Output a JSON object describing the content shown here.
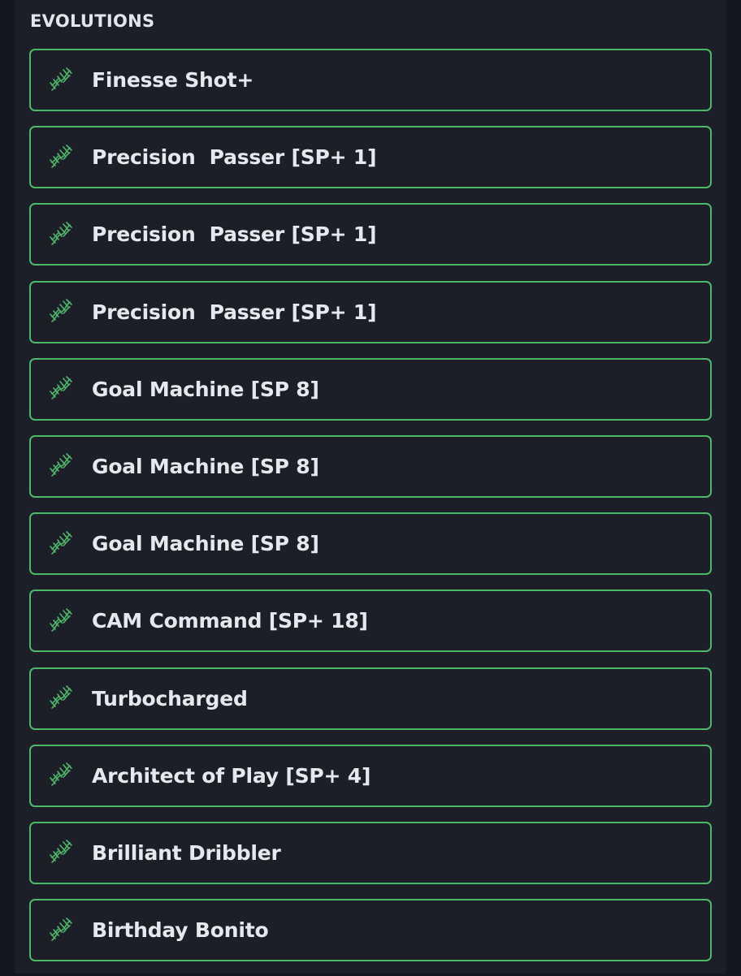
{
  "section": {
    "title": "EVOLUTIONS"
  },
  "colors": {
    "page_background": "#14171d",
    "panel_background": "#1c1f28",
    "item_border": "#4cb86a",
    "icon": "#4cb86a",
    "text": "#e6e8ef"
  },
  "evolutions": [
    {
      "label": "Finesse Shot+",
      "icon": "dna-icon"
    },
    {
      "label": "Precision  Passer [SP+ 1]",
      "icon": "dna-icon"
    },
    {
      "label": "Precision  Passer [SP+ 1]",
      "icon": "dna-icon"
    },
    {
      "label": "Precision  Passer [SP+ 1]",
      "icon": "dna-icon"
    },
    {
      "label": "Goal Machine [SP 8]",
      "icon": "dna-icon"
    },
    {
      "label": "Goal Machine [SP 8]",
      "icon": "dna-icon"
    },
    {
      "label": "Goal Machine [SP 8]",
      "icon": "dna-icon"
    },
    {
      "label": "CAM Command [SP+ 18]",
      "icon": "dna-icon"
    },
    {
      "label": "Turbocharged",
      "icon": "dna-icon"
    },
    {
      "label": "Architect of Play [SP+ 4]",
      "icon": "dna-icon"
    },
    {
      "label": "Brilliant Dribbler",
      "icon": "dna-icon"
    },
    {
      "label": "Birthday Bonito",
      "icon": "dna-icon"
    }
  ]
}
